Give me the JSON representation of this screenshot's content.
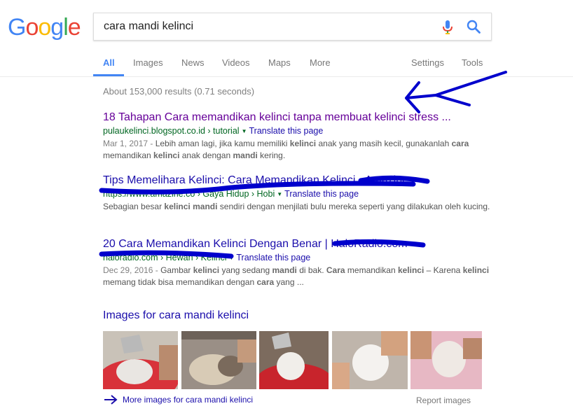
{
  "logo": {
    "letters": [
      "G",
      "o",
      "o",
      "g",
      "l",
      "e"
    ],
    "colors": [
      "#4285f4",
      "#ea4335",
      "#fbbc05",
      "#4285f4",
      "#34a853",
      "#ea4335"
    ]
  },
  "search": {
    "query": "cara mandi kelinci"
  },
  "tabs": [
    {
      "label": "All"
    },
    {
      "label": "Images"
    },
    {
      "label": "News"
    },
    {
      "label": "Videos"
    },
    {
      "label": "Maps"
    },
    {
      "label": "More"
    },
    {
      "label": "Settings"
    },
    {
      "label": "Tools"
    }
  ],
  "stats": "About 153,000 results (0.71 seconds)",
  "results": [
    {
      "title": "18 Tahapan Cara memandikan kelinci tanpa membuat kelinci stress ...",
      "url": "pulaukelinci.blogspot.co.id › tutorial",
      "translate": "Translate this page",
      "date": "Mar 1, 2017 - ",
      "snippet_parts": [
        "Lebih aman lagi, jika kamu memiliki ",
        "kelinci",
        " anak yang masih kecil, gunakanlah ",
        "cara",
        " memandikan ",
        "kelinci",
        " anak dengan ",
        "mandi",
        " kering."
      ]
    },
    {
      "title": "Tips Memelihara Kelinci: Cara Memandikan Kelinci - Amazine",
      "url": "https://www.amazine.co › Gaya Hidup › Hobi",
      "translate": "Translate this page",
      "date": "",
      "snippet_parts": [
        "Sebagian besar ",
        "kelinci mandi",
        " sendiri dengan menjilati bulu mereka seperti yang dilakukan oleh kucing."
      ]
    },
    {
      "title": "20 Cara Memandikan Kelinci Dengan Benar | HaloRadio.com",
      "url": "haloradio.com › Hewan › Kelinci",
      "translate": "Translate this page",
      "date": "Dec 29, 2016 - ",
      "snippet_parts": [
        "Gambar ",
        "kelinci",
        " yang sedang ",
        "mandi",
        " di bak. ",
        "Cara",
        " memandikan ",
        "kelinci",
        " – Karena ",
        "kelinci",
        " memang tidak bisa memandikan dengan ",
        "cara",
        " yang ..."
      ]
    }
  ],
  "images": {
    "heading": "Images for cara mandi kelinci",
    "more": "More images for cara mandi kelinci",
    "report": "Report images"
  },
  "colors": {
    "link": "#1a0dab",
    "visited": "#660099",
    "url": "#006621",
    "accent": "#4285f4",
    "annotation": "#0000cc"
  }
}
